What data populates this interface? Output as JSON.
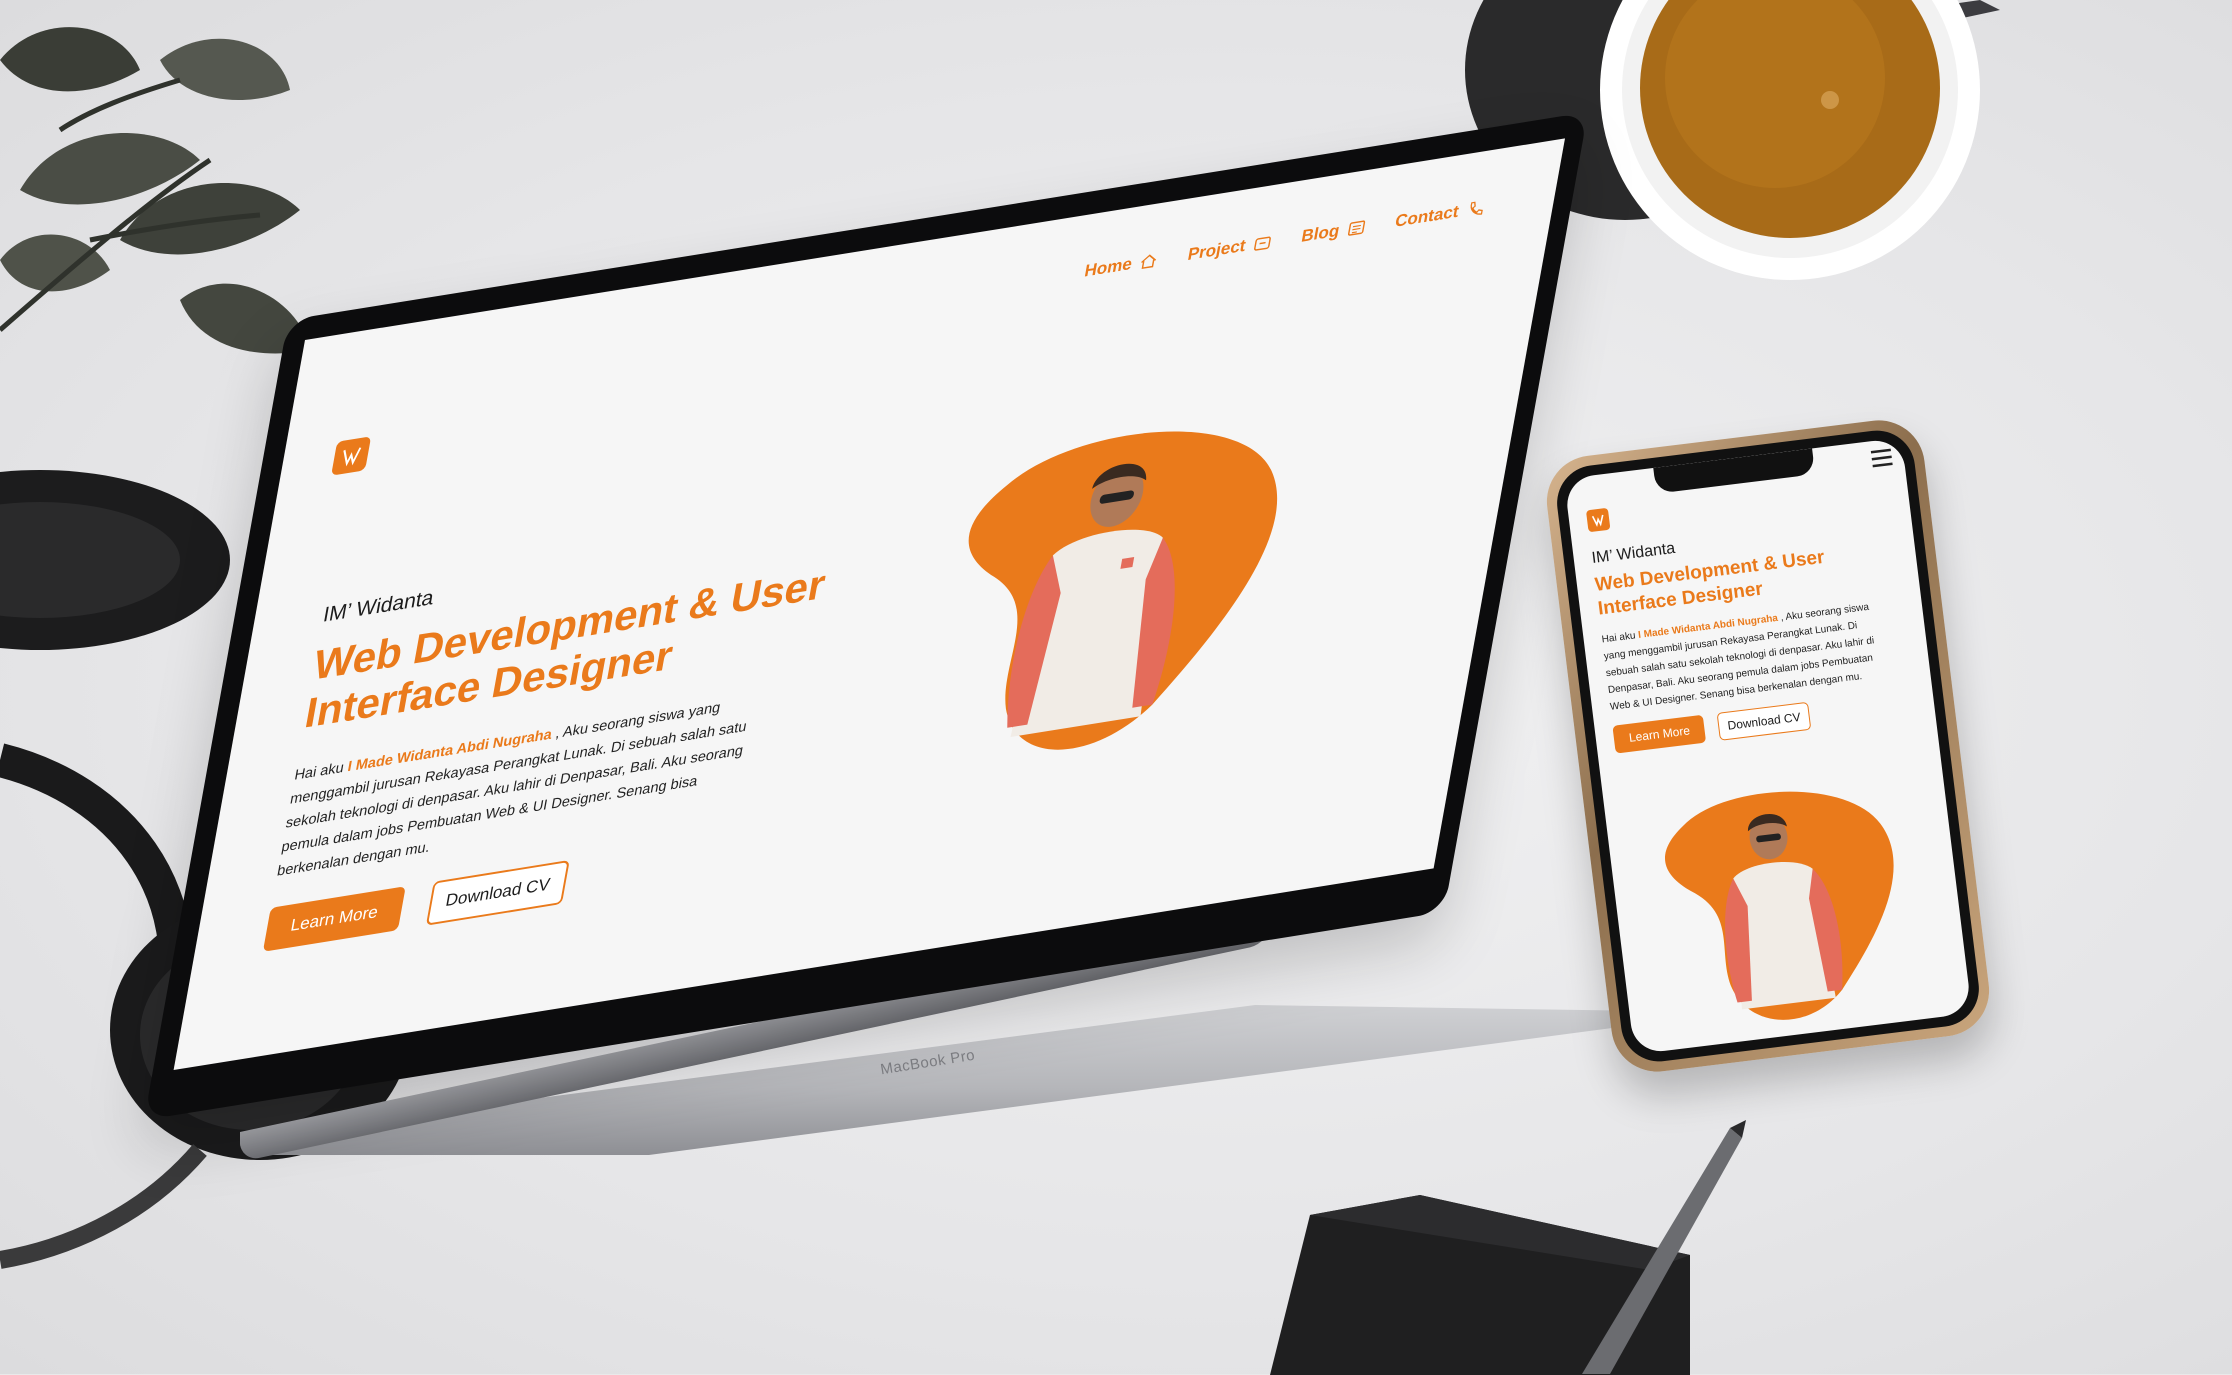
{
  "site": {
    "nav": [
      {
        "label": "Home",
        "icon": "home-icon"
      },
      {
        "label": "Project",
        "icon": "project-icon"
      },
      {
        "label": "Blog",
        "icon": "blog-icon"
      },
      {
        "label": "Contact",
        "icon": "phone-icon"
      }
    ],
    "brand": "IM’ Widanta",
    "headline": "Web Development & User Interface Designer",
    "bio_prefix": "Hai aku ",
    "bio_name": "I Made Widanta Abdi Nugraha",
    "bio_suffix": " , Aku seorang siswa yang menggambil jurusan Rekayasa Perangkat Lunak. Di sebuah salah satu sekolah teknologi di denpasar. Aku lahir di Denpasar, Bali. Aku seorang pemula dalam jobs Pembuatan Web & UI Designer. Senang bisa berkenalan dengan mu.",
    "learn_more": "Learn More",
    "download_cv": "Download CV"
  },
  "laptop": {
    "label": "MacBook Pro"
  },
  "colors": {
    "accent": "#EA7A1B",
    "background": "#F6F6F6",
    "text": "#1C1C1C"
  }
}
